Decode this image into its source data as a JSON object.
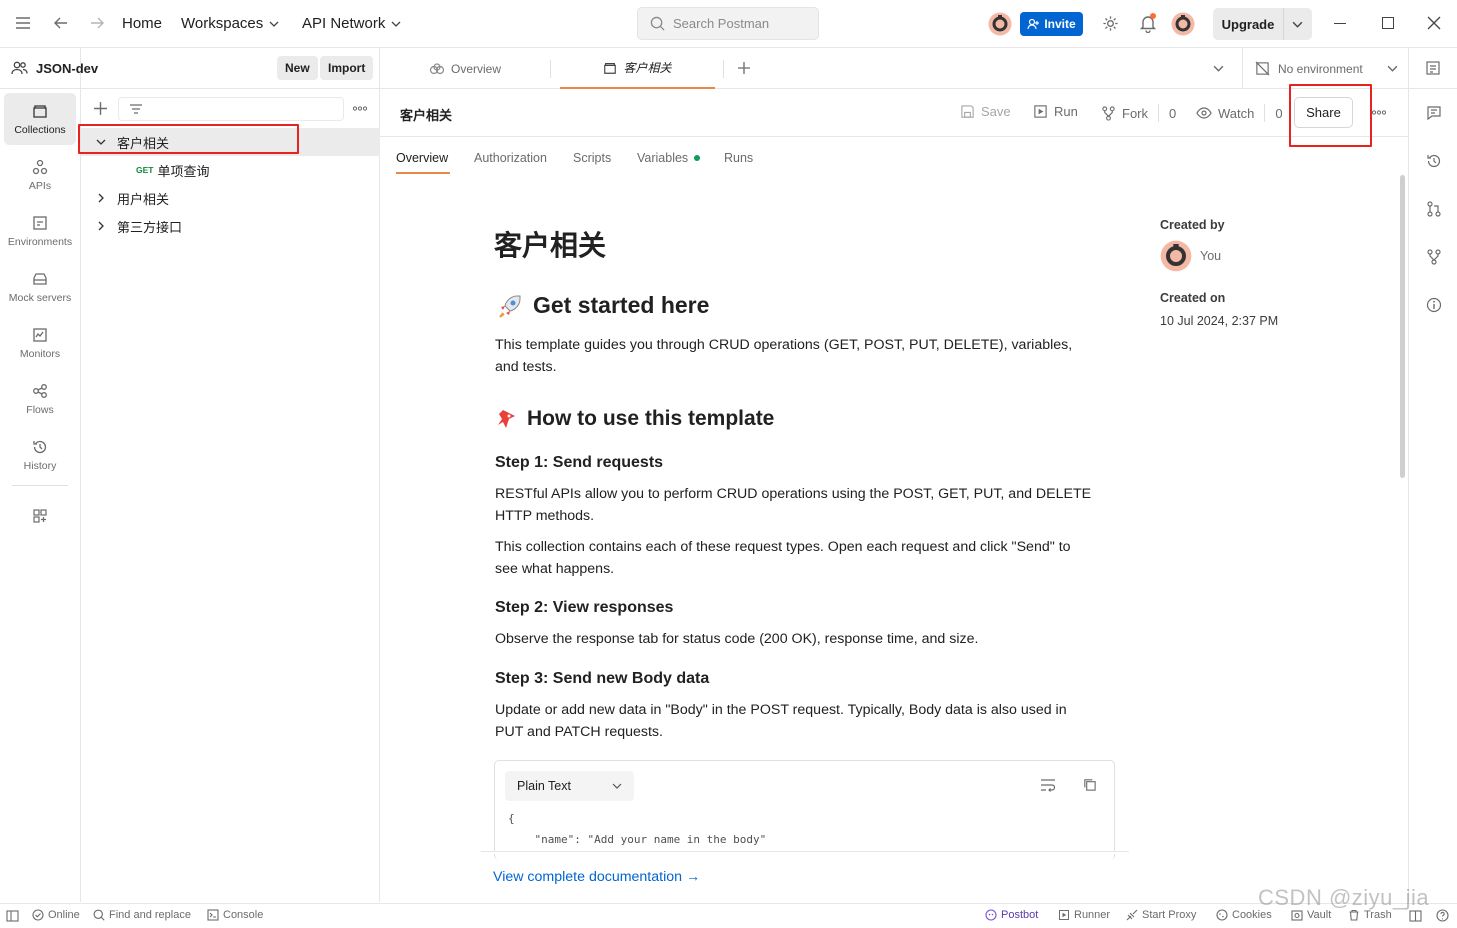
{
  "topbar": {
    "home": "Home",
    "workspaces": "Workspaces",
    "api_network": "API Network",
    "search_placeholder": "Search Postman",
    "invite": "Invite",
    "upgrade": "Upgrade"
  },
  "rail": {
    "items": [
      {
        "label": "Collections",
        "icon": "collections-icon"
      },
      {
        "label": "APIs",
        "icon": "apis-icon"
      },
      {
        "label": "Environments",
        "icon": "environments-icon"
      },
      {
        "label": "Mock servers",
        "icon": "mock-servers-icon"
      },
      {
        "label": "Monitors",
        "icon": "monitors-icon"
      },
      {
        "label": "Flows",
        "icon": "flows-icon"
      },
      {
        "label": "History",
        "icon": "history-icon"
      }
    ]
  },
  "sidebar": {
    "workspace_name": "JSON-dev",
    "new_label": "New",
    "import_label": "Import",
    "tree": [
      {
        "label": "客户相关",
        "expanded": true,
        "selected": true
      },
      {
        "method": "GET",
        "label": "单项查询"
      },
      {
        "label": "用户相关",
        "expanded": false
      },
      {
        "label": "第三方接口",
        "expanded": false
      }
    ]
  },
  "tabs": {
    "overview": "Overview",
    "active": "客户相关",
    "environment": "No environment"
  },
  "header": {
    "title": "客户相关",
    "save": "Save",
    "run": "Run",
    "fork": "Fork",
    "fork_count": "0",
    "watch": "Watch",
    "watch_count": "0",
    "share": "Share"
  },
  "subtabs": [
    "Overview",
    "Authorization",
    "Scripts",
    "Variables",
    "Runs"
  ],
  "doc": {
    "title": "客户相关",
    "h_get_started": "Get started here",
    "p_intro_1": "This template guides you through CRUD operations (GET, POST, PUT, DELETE), variables,",
    "p_intro_2": "and tests.",
    "h_how_to": "How to use this template",
    "step1": "Step 1: Send requests",
    "step1_p1a": "RESTful APIs allow you to perform CRUD operations using the POST, GET, PUT, and DELETE",
    "step1_p1b": "HTTP methods.",
    "step1_p2a": "This collection contains each of these request types. Open each request and click \"Send\" to",
    "step1_p2b": "see what happens.",
    "step2": "Step 2: View responses",
    "step2_p": "Observe the response tab for status code (200 OK), response time, and size.",
    "step3": "Step 3: Send new Body data",
    "step3_pa": "Update or add new data in \"Body\" in the POST request. Typically, Body data is also used in",
    "step3_pb": "PUT and PATCH requests.",
    "code_lang": "Plain Text",
    "code_line1": "{",
    "code_line2": "    \"name\": \"Add your name in the body\"",
    "view_docs": "View complete documentation →"
  },
  "meta": {
    "created_by_label": "Created by",
    "created_by": "You",
    "created_on_label": "Created on",
    "created_on": "10 Jul 2024, 2:37 PM"
  },
  "statusbar": {
    "online": "Online",
    "find_replace": "Find and replace",
    "console": "Console",
    "postbot": "Postbot",
    "runner": "Runner",
    "start_proxy": "Start Proxy",
    "cookies": "Cookies",
    "vault": "Vault",
    "trash": "Trash"
  },
  "watermark": "CSDN @ziyu_jia",
  "colors": {
    "accent": "#0265d2",
    "tab_underline": "#e68a4c",
    "highlight_box": "#e8231f",
    "get_method": "#0f8a3e",
    "variables_dot": "#0f9d58",
    "link": "#0265d2"
  }
}
